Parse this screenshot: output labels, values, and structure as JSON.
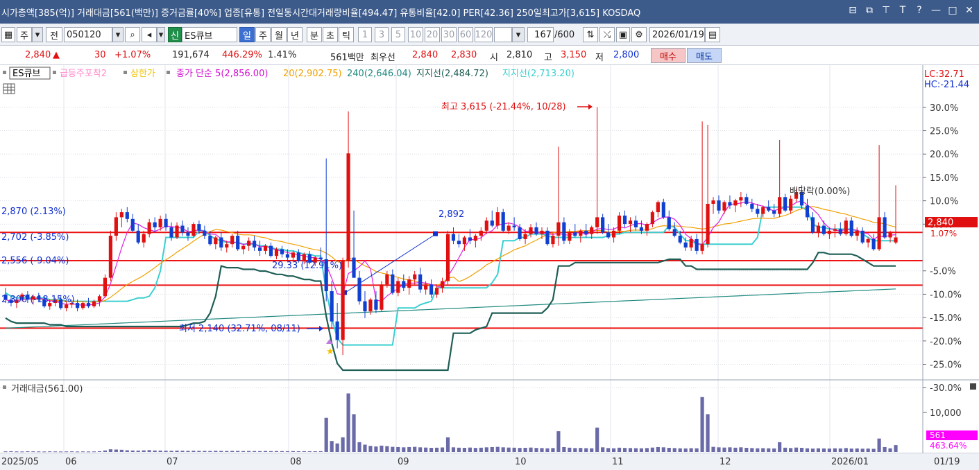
{
  "title_bar": {
    "text": "시가총액[385(억)] 거래대금[561(백만)] 증거금률[40%] 업종[유통] 전일동시간대거래량비율[494.47] 유통비율[42.0] PER[42.36] 250일최고가[3,615] KOSDAQ",
    "controls": [
      "⊟",
      "⧉",
      "⊤",
      "T",
      "?",
      "—",
      "□",
      "✕"
    ]
  },
  "toolbar": {
    "market": "주",
    "prev_label": "전",
    "code": "050120",
    "stock_badge": "신",
    "stock_name": "ES큐브",
    "periods": [
      "일",
      "주",
      "월",
      "년",
      "분",
      "초",
      "틱"
    ],
    "active_period": "일",
    "intervals": [
      "1",
      "3",
      "5",
      "10",
      "20",
      "30",
      "60",
      "120"
    ],
    "count_value": "167",
    "count_total": "/600",
    "date": "2026/01/19"
  },
  "quote": {
    "price": "2,840",
    "change_arrow": "▲",
    "change": "30",
    "change_pct": "+1.07%",
    "volume": "191,674",
    "volume_ratio": "446.29%",
    "turnover": "1.41%",
    "amount": "561백만",
    "best_label": "최우선",
    "ask": "2,840",
    "bid": "2,830",
    "open_label": "시",
    "open": "2,810",
    "high_label": "고",
    "high": "3,150",
    "low_label": "저",
    "low": "2,800",
    "buy_label": "매수",
    "sell_label": "매도"
  },
  "colors": {
    "up": "#e01010",
    "down": "#1040d0",
    "ma5": "#e020e0",
    "ma20": "#f0a000",
    "ma240": "#208a80",
    "support1": "#1e5e55",
    "support2": "#3ccfd0",
    "hline": "#ee1111",
    "volume_bar": "#6a6aa8"
  },
  "legend": {
    "stock": "ES큐브",
    "item1": "급등주포착2",
    "item2": "상한가",
    "item3": "종가 단순 5(2,856.00)",
    "item4": "20(2,902.75)",
    "item5": "240(2,646.04)",
    "item6": "지지선(2,484.72)",
    "item7": "지지선(2,713.20)"
  },
  "right_header": {
    "lc": "LC:32.71",
    "hc": "HC:-21.44"
  },
  "y_axis_labels": [
    "30.0%",
    "25.0%",
    "20.0%",
    "15.0%",
    "10.0%",
    "5.0%",
    "-5.0%",
    "-10.0%",
    "-15.0%",
    "-20.0%",
    "-25.0%",
    "-30.0%"
  ],
  "price_tag": "2,840",
  "pct_tag": "1.07%",
  "horizontal_lines": [
    {
      "label": "2,870 (2.13%)"
    },
    {
      "label": "2,702 (-3.85%)"
    },
    {
      "label": "2,556 (-9.04%)"
    },
    {
      "label": "2,300 (-18.15%)"
    }
  ],
  "annotations": {
    "high": "최고 3,615 (-21.44%, 10/28)",
    "low": "최저 2,140 (32.71%, 08/11)",
    "trend_end": "2,892",
    "trend_start": "29.33 (12.91%)",
    "exdiv": "배당락(0.00%)",
    "star": "★"
  },
  "volume_panel": {
    "title": "거래대금(561.00)",
    "axis_label": "10,000",
    "value_tag": "561",
    "pct_tag": "463.64%"
  },
  "x_axis_labels": [
    "2025/05",
    "06",
    "07",
    "08",
    "09",
    "10",
    "11",
    "12",
    "2026/01"
  ],
  "x_axis_right": "01/19",
  "chart_data": {
    "type": "candlestick",
    "title": "",
    "ylim": [
      2050,
      3700
    ],
    "candles": [
      [
        2500,
        2540,
        2450,
        2470
      ],
      [
        2470,
        2490,
        2430,
        2450
      ],
      [
        2450,
        2480,
        2420,
        2470
      ],
      [
        2470,
        2510,
        2460,
        2500
      ],
      [
        2500,
        2520,
        2450,
        2470
      ],
      [
        2470,
        2500,
        2440,
        2490
      ],
      [
        2490,
        2510,
        2460,
        2470
      ],
      [
        2470,
        2490,
        2420,
        2430
      ],
      [
        2430,
        2470,
        2410,
        2450
      ],
      [
        2450,
        2480,
        2430,
        2470
      ],
      [
        2470,
        2490,
        2410,
        2420
      ],
      [
        2420,
        2460,
        2400,
        2440
      ],
      [
        2440,
        2470,
        2420,
        2450
      ],
      [
        2450,
        2470,
        2400,
        2420
      ],
      [
        2420,
        2460,
        2410,
        2450
      ],
      [
        2450,
        2480,
        2420,
        2430
      ],
      [
        2430,
        2470,
        2420,
        2460
      ],
      [
        2460,
        2500,
        2430,
        2490
      ],
      [
        2490,
        2620,
        2480,
        2600
      ],
      [
        2600,
        2880,
        2580,
        2850
      ],
      [
        2850,
        2990,
        2820,
        2960
      ],
      [
        2960,
        3010,
        2900,
        2990
      ],
      [
        2990,
        3020,
        2930,
        2950
      ],
      [
        2950,
        2980,
        2870,
        2880
      ],
      [
        2880,
        2920,
        2800,
        2810
      ],
      [
        2810,
        2880,
        2780,
        2860
      ],
      [
        2860,
        2950,
        2840,
        2930
      ],
      [
        2930,
        2960,
        2870,
        2900
      ],
      [
        2900,
        2970,
        2880,
        2950
      ],
      [
        2950,
        2980,
        2880,
        2900
      ],
      [
        2900,
        2930,
        2820,
        2840
      ],
      [
        2840,
        2930,
        2830,
        2910
      ],
      [
        2910,
        2940,
        2850,
        2870
      ],
      [
        2870,
        2900,
        2820,
        2850
      ],
      [
        2850,
        2930,
        2840,
        2920
      ],
      [
        2920,
        2940,
        2860,
        2880
      ],
      [
        2880,
        2910,
        2830,
        2850
      ],
      [
        2850,
        2880,
        2790,
        2800
      ],
      [
        2800,
        2850,
        2770,
        2840
      ],
      [
        2840,
        2870,
        2760,
        2780
      ],
      [
        2780,
        2820,
        2750,
        2800
      ],
      [
        2800,
        2860,
        2780,
        2850
      ],
      [
        2850,
        2880,
        2760,
        2770
      ],
      [
        2770,
        2800,
        2740,
        2790
      ],
      [
        2790,
        2840,
        2760,
        2820
      ],
      [
        2820,
        2850,
        2760,
        2780
      ],
      [
        2780,
        2820,
        2730,
        2760
      ],
      [
        2760,
        2800,
        2740,
        2790
      ],
      [
        2790,
        2810,
        2720,
        2730
      ],
      [
        2730,
        2780,
        2710,
        2770
      ],
      [
        2770,
        2790,
        2720,
        2740
      ],
      [
        2740,
        2770,
        2700,
        2720
      ],
      [
        2720,
        2760,
        2700,
        2750
      ],
      [
        2750,
        2770,
        2690,
        2700
      ],
      [
        2700,
        2750,
        2680,
        2740
      ],
      [
        2740,
        2760,
        2680,
        2690
      ],
      [
        2690,
        2730,
        2670,
        2720
      ],
      [
        2720,
        2780,
        2700,
        2710
      ],
      [
        2710,
        3310,
        2460,
        2520
      ],
      [
        2520,
        2580,
        2300,
        2340
      ],
      [
        2340,
        2450,
        2180,
        2230
      ],
      [
        2230,
        2720,
        2140,
        2700
      ],
      [
        2700,
        3590,
        2660,
        3340
      ],
      [
        2720,
        3000,
        2600,
        2600
      ],
      [
        2600,
        2640,
        2440,
        2460
      ],
      [
        2460,
        2520,
        2360,
        2400
      ],
      [
        2400,
        2480,
        2380,
        2470
      ],
      [
        2470,
        2520,
        2390,
        2410
      ],
      [
        2410,
        2580,
        2400,
        2560
      ],
      [
        2560,
        2640,
        2540,
        2620
      ],
      [
        2620,
        2650,
        2500,
        2510
      ],
      [
        2510,
        2600,
        2490,
        2580
      ],
      [
        2580,
        2620,
        2520,
        2540
      ],
      [
        2540,
        2610,
        2500,
        2590
      ],
      [
        2590,
        2640,
        2560,
        2620
      ],
      [
        2620,
        2660,
        2510,
        2530
      ],
      [
        2530,
        2580,
        2500,
        2560
      ],
      [
        2560,
        2590,
        2480,
        2500
      ],
      [
        2500,
        2560,
        2480,
        2540
      ],
      [
        2540,
        2600,
        2510,
        2580
      ],
      [
        2580,
        2880,
        2560,
        2860
      ],
      [
        2860,
        2900,
        2800,
        2820
      ],
      [
        2820,
        2860,
        2780,
        2800
      ],
      [
        2800,
        2850,
        2760,
        2840
      ],
      [
        2840,
        2890,
        2800,
        2820
      ],
      [
        2820,
        2860,
        2780,
        2850
      ],
      [
        2850,
        2900,
        2820,
        2880
      ],
      [
        2880,
        2960,
        2860,
        2940
      ],
      [
        2940,
        3000,
        2900,
        2910
      ],
      [
        2910,
        3020,
        2890,
        2990
      ],
      [
        2990,
        3010,
        2870,
        2880
      ],
      [
        2880,
        2930,
        2860,
        2910
      ],
      [
        2910,
        2960,
        2880,
        2900
      ],
      [
        2900,
        2920,
        2820,
        2830
      ],
      [
        2830,
        2890,
        2800,
        2860
      ],
      [
        2860,
        2920,
        2840,
        2900
      ],
      [
        2900,
        2930,
        2850,
        2860
      ],
      [
        2860,
        2900,
        2830,
        2880
      ],
      [
        2880,
        2900,
        2790,
        2800
      ],
      [
        2800,
        2870,
        2780,
        2850
      ],
      [
        2850,
        3380,
        2790,
        2930
      ],
      [
        2930,
        2960,
        2800,
        2820
      ],
      [
        2820,
        2890,
        2800,
        2870
      ],
      [
        2870,
        2920,
        2840,
        2850
      ],
      [
        2850,
        2890,
        2810,
        2880
      ],
      [
        2880,
        2920,
        2840,
        2860
      ],
      [
        2860,
        2910,
        2830,
        2900
      ],
      [
        2900,
        3615,
        2860,
        2960
      ],
      [
        2960,
        2980,
        2860,
        2870
      ],
      [
        2870,
        2920,
        2830,
        2840
      ],
      [
        2840,
        2900,
        2810,
        2880
      ],
      [
        2880,
        2990,
        2860,
        2970
      ],
      [
        2970,
        3000,
        2900,
        2920
      ],
      [
        2920,
        2960,
        2870,
        2940
      ],
      [
        2940,
        2970,
        2880,
        2900
      ],
      [
        2900,
        2940,
        2860,
        2880
      ],
      [
        2880,
        2930,
        2850,
        2920
      ],
      [
        2920,
        3000,
        2900,
        2990
      ],
      [
        2990,
        3060,
        2960,
        3050
      ],
      [
        3050,
        3070,
        2950,
        2960
      ],
      [
        2960,
        3000,
        2880,
        2890
      ],
      [
        2890,
        2930,
        2840,
        2850
      ],
      [
        2850,
        2880,
        2800,
        2810
      ],
      [
        2810,
        2840,
        2760,
        2780
      ],
      [
        2780,
        2850,
        2760,
        2830
      ],
      [
        2830,
        2860,
        2740,
        2760
      ],
      [
        2760,
        3530,
        2740,
        2800
      ],
      [
        2800,
        3510,
        2780,
        3040
      ],
      [
        3040,
        3080,
        2980,
        3060
      ],
      [
        3060,
        3090,
        2980,
        3000
      ],
      [
        3000,
        3060,
        2980,
        3050
      ],
      [
        3050,
        3090,
        3010,
        3030
      ],
      [
        3030,
        3070,
        2990,
        3060
      ],
      [
        3060,
        3110,
        3020,
        3080
      ],
      [
        3080,
        3100,
        3030,
        3040
      ],
      [
        3040,
        3070,
        2990,
        3010
      ],
      [
        3010,
        3040,
        2960,
        2980
      ],
      [
        2980,
        3030,
        2960,
        3020
      ],
      [
        3020,
        3060,
        2990,
        3000
      ],
      [
        3000,
        3040,
        2960,
        2980
      ],
      [
        2980,
        3420,
        2960,
        3080
      ],
      [
        3080,
        3100,
        2990,
        3000
      ],
      [
        3000,
        3090,
        2980,
        3070
      ],
      [
        3070,
        3130,
        3050,
        3110
      ],
      [
        3110,
        3150,
        3010,
        3030
      ],
      [
        3030,
        3070,
        2940,
        2960
      ],
      [
        2960,
        2990,
        2860,
        2870
      ],
      [
        2870,
        2930,
        2840,
        2910
      ],
      [
        2910,
        2940,
        2850,
        2860
      ],
      [
        2860,
        2900,
        2830,
        2880
      ],
      [
        2880,
        2920,
        2840,
        2890
      ],
      [
        2890,
        2930,
        2850,
        2860
      ],
      [
        2860,
        2960,
        2850,
        2940
      ],
      [
        2940,
        2960,
        2840,
        2850
      ],
      [
        2850,
        2900,
        2820,
        2880
      ],
      [
        2880,
        2900,
        2800,
        2810
      ],
      [
        2810,
        2840,
        2780,
        2830
      ],
      [
        2830,
        2860,
        2760,
        2770
      ],
      [
        2770,
        3390,
        2760,
        2960
      ],
      [
        2960,
        2990,
        2830,
        2840
      ],
      [
        2840,
        2880,
        2810,
        2870
      ],
      [
        2810,
        3150,
        2800,
        2840
      ]
    ],
    "volume": [
      50,
      60,
      45,
      40,
      55,
      50,
      45,
      40,
      50,
      45,
      40,
      45,
      50,
      40,
      45,
      40,
      45,
      60,
      120,
      220,
      200,
      180,
      140,
      120,
      110,
      130,
      150,
      120,
      110,
      100,
      95,
      110,
      100,
      90,
      100,
      90,
      85,
      80,
      95,
      85,
      80,
      90,
      85,
      75,
      80,
      75,
      70,
      80,
      70,
      75,
      70,
      65,
      70,
      60,
      65,
      60,
      55,
      65,
      2800,
      900,
      700,
      1200,
      4800,
      3100,
      800,
      600,
      500,
      450,
      520,
      480,
      420,
      400,
      380,
      400,
      420,
      380,
      360,
      340,
      350,
      370,
      1200,
      380,
      350,
      340,
      360,
      330,
      350,
      380,
      400,
      420,
      380,
      360,
      350,
      330,
      340,
      360,
      330,
      320,
      300,
      320,
      1700,
      400,
      350,
      320,
      330,
      310,
      300,
      2000,
      380,
      320,
      300,
      350,
      330,
      320,
      310,
      300,
      320,
      360,
      400,
      380,
      340,
      320,
      300,
      290,
      310,
      300,
      4500,
      3100,
      420,
      380,
      360,
      380,
      350,
      380,
      340,
      320,
      300,
      310,
      300,
      290,
      800,
      350,
      320,
      360,
      340,
      300,
      280,
      300,
      290,
      280,
      300,
      290,
      320,
      280,
      290,
      270,
      280,
      260,
      1100,
      400,
      300,
      561
    ]
  }
}
